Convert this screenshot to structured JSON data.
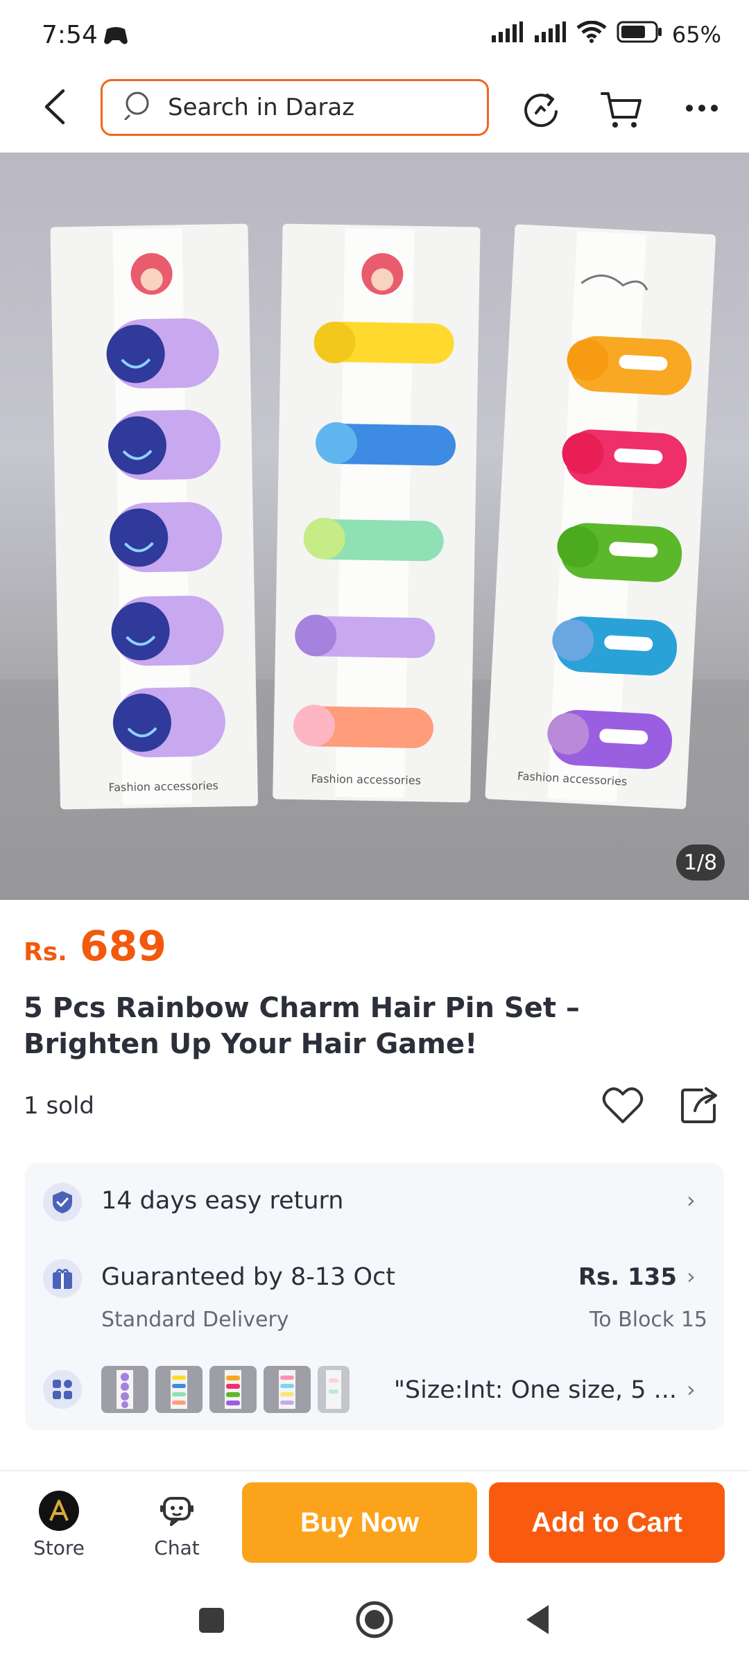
{
  "status_bar": {
    "time": "7:54",
    "battery": "65%",
    "icons": [
      "game-icon",
      "signal-icon",
      "signal-icon",
      "wifi-icon",
      "battery-icon"
    ]
  },
  "header": {
    "search_placeholder": "Search in Daraz",
    "icons": [
      "back-arrow-icon",
      "refresh-icon",
      "cart-icon",
      "more-icon"
    ]
  },
  "gallery": {
    "counter": "1/8"
  },
  "product": {
    "currency": "Rs.",
    "price": "689",
    "title": "5 Pcs Rainbow Charm Hair Pin Set  – Brighten Up Your Hair Game!",
    "sold": "1 sold"
  },
  "info": {
    "return": "14 days easy return",
    "delivery_title": "Guaranteed by 8-13 Oct",
    "delivery_sub": "Standard Delivery",
    "delivery_price": "Rs. 135",
    "delivery_location": "To Block 15",
    "variant": "\"Size:Int: One size, 5 ..."
  },
  "actions": {
    "store_label": "Store",
    "chat_label": "Chat",
    "buy_now": "Buy Now",
    "add_to_cart": "Add to Cart"
  },
  "colors": {
    "accent": "#f85b0f",
    "buy_now": "#fca31c",
    "price": "#f2590d",
    "search_border": "#f0661e"
  }
}
